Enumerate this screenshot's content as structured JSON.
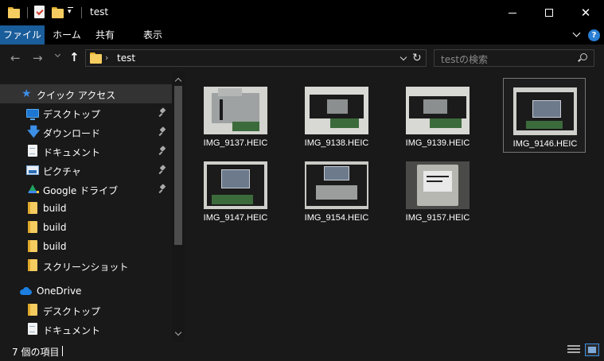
{
  "window": {
    "title": "test",
    "minimize_icon": "minimize-icon",
    "maximize_icon": "maximize-icon",
    "close_glyph": "✕"
  },
  "ribbon": {
    "tabs": [
      "ファイル",
      "ホーム",
      "共有",
      "表示"
    ],
    "help_glyph": "?"
  },
  "address": {
    "path": "test",
    "separator": "›",
    "refresh_glyph": "↻"
  },
  "nav": {
    "back_glyph": "←",
    "forward_glyph": "→",
    "up_glyph": "↑"
  },
  "search": {
    "placeholder": "testの検索"
  },
  "sidebar": {
    "items": [
      {
        "label": "クイック アクセス",
        "icon": "star-icon"
      },
      {
        "label": "デスクトップ",
        "icon": "desktop-icon",
        "pinned": true
      },
      {
        "label": "ダウンロード",
        "icon": "download-icon",
        "pinned": true
      },
      {
        "label": "ドキュメント",
        "icon": "document-icon",
        "pinned": true
      },
      {
        "label": "ピクチャ",
        "icon": "pictures-icon",
        "pinned": true
      },
      {
        "label": "Google ドライブ",
        "icon": "google-drive-icon",
        "pinned": true
      },
      {
        "label": "build",
        "icon": "folder-icon"
      },
      {
        "label": "build",
        "icon": "folder-icon"
      },
      {
        "label": "build",
        "icon": "folder-icon"
      },
      {
        "label": "スクリーンショット",
        "icon": "folder-icon"
      },
      {
        "label": "OneDrive",
        "icon": "onedrive-icon"
      },
      {
        "label": "デスクトップ",
        "icon": "folder-icon"
      },
      {
        "label": "ドキュメント",
        "icon": "document-icon"
      }
    ],
    "star_glyph": "★",
    "download_glyph": "🡇"
  },
  "files": [
    {
      "name": "IMG_9137.HEIC"
    },
    {
      "name": "IMG_9138.HEIC"
    },
    {
      "name": "IMG_9139.HEIC"
    },
    {
      "name": "IMG_9146.HEIC",
      "selected": true
    },
    {
      "name": "IMG_9147.HEIC"
    },
    {
      "name": "IMG_9154.HEIC"
    },
    {
      "name": "IMG_9157.HEIC"
    }
  ],
  "status": {
    "item_count": "7 個の項目"
  },
  "colors": {
    "accent": "#1a5d9b",
    "folder": "#f4cc5f",
    "background": "#191919"
  }
}
